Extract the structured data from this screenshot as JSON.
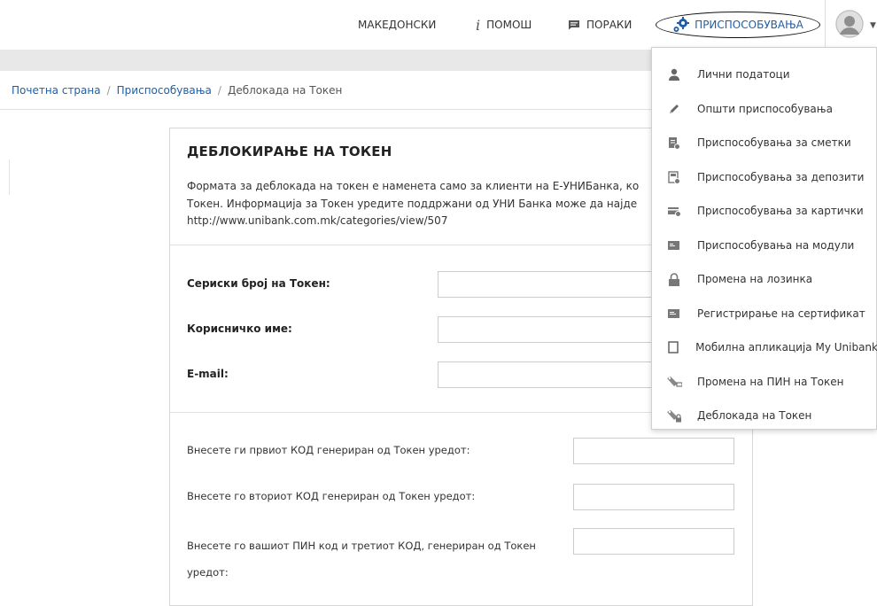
{
  "topnav": {
    "lang_label": "МАКЕДОНСКИ",
    "help_label": "ПОМОШ",
    "messages_label": "ПОРАКИ",
    "customize_label": "ПРИСПОСОБУВАЊА",
    "accent": "#1f5fa8"
  },
  "breadcrumb": {
    "home": "Почетна страна",
    "settings": "Приспособувања",
    "current": "Деблокада на Токен"
  },
  "form": {
    "title": "ДЕБЛОКИРАЊЕ НА ТОКЕН",
    "description": "Формата за деблокада на токен е наменета само за клиенти на Е-УНИБанка, ко\nТокен. Информација за Токен уредите поддржани од УНИ Банка може да најде\nhttp://www.unibank.com.mk/categories/view/507",
    "serial_label": "Сериски број на Токен:",
    "username_label": "Корисничко име:",
    "email_label": "E-mail:",
    "code1_label": "Внесете ги првиот КОД генериран од Токен уредот:",
    "code2_label": "Внесете го вториот КОД генериран од Токен уредот:",
    "code3_label": "Внесете го вашиот ПИН код и третиот КОД, генериран од Токен\nуредот:"
  },
  "dropdown": {
    "items": [
      {
        "label": "Лични податоци",
        "icon": "user-icon"
      },
      {
        "label": "Општи приспособувања",
        "icon": "pencil-icon"
      },
      {
        "label": "Приспособувања за сметки",
        "icon": "account-settings-icon"
      },
      {
        "label": "Приспособувања за депозити",
        "icon": "deposit-settings-icon"
      },
      {
        "label": "Приспособувања за картички",
        "icon": "card-settings-icon"
      },
      {
        "label": "Приспособувања на модули",
        "icon": "module-icon"
      },
      {
        "label": "Промена на лозинка",
        "icon": "lock-icon"
      },
      {
        "label": "Регистрирање на сертификат",
        "icon": "certificate-icon"
      },
      {
        "label": "Мобилна апликација My Unibank",
        "icon": "mobile-icon"
      },
      {
        "label": "Промена на ПИН на Токен",
        "icon": "token-pin-icon"
      },
      {
        "label": "Деблокада на Токен",
        "icon": "token-unblock-icon"
      }
    ]
  }
}
